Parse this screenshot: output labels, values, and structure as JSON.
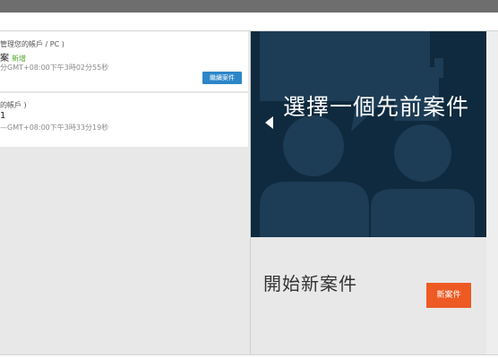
{
  "cases": [
    {
      "account": "管理您的帳戶 / PC )",
      "title": "案",
      "badge": "新增",
      "date": "分GMT+08:00下午3時02分55秒"
    },
    {
      "account": "的帳戶 )",
      "title": "1",
      "date": "—GMT+08:00下午3時33分19秒"
    }
  ],
  "continue_label": "繼續案件",
  "select_previous": "選擇一個先前案件",
  "start_new": "開始新案件",
  "new_case_label": "新案件",
  "colors": {
    "dark_panel": "#0f2a3e",
    "illustration": "#1d3c55",
    "continue_button": "#2c86c8",
    "new_case_button": "#ee5a24",
    "badge": "#55a630"
  }
}
